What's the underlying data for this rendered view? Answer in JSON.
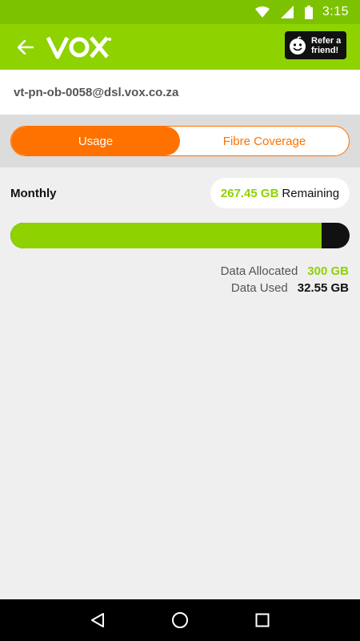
{
  "status_bar": {
    "time": "3:15",
    "icons": [
      "wifi-icon",
      "signal-icon",
      "battery-icon"
    ]
  },
  "app_bar": {
    "back_icon": "arrow-back-icon",
    "logo_text": "VOX",
    "refer_label_line1": "Refer a",
    "refer_label_line2": "friend!",
    "colors": {
      "background": "#8ed200",
      "status": "#7dc200"
    }
  },
  "account": {
    "username": "vt-pn-ob-0058@dsl.vox.co.za"
  },
  "tabs": [
    {
      "label": "Usage",
      "active": true
    },
    {
      "label": "Fibre Coverage",
      "active": false
    }
  ],
  "usage": {
    "period_label": "Monthly",
    "remaining_amount": "267.45 GB",
    "remaining_label": "Remaining",
    "used_fraction": 0.9185,
    "data_allocated_label": "Data Allocated",
    "data_allocated_value": "300 GB",
    "data_used_label": "Data Used",
    "data_used_value": "32.55 GB",
    "colors": {
      "accent": "#8ed200",
      "tab": "#ff7200",
      "bar_empty": "#111111"
    }
  },
  "nav_bar": {
    "icons": [
      "back-triangle-icon",
      "home-circle-icon",
      "recents-square-icon"
    ]
  }
}
